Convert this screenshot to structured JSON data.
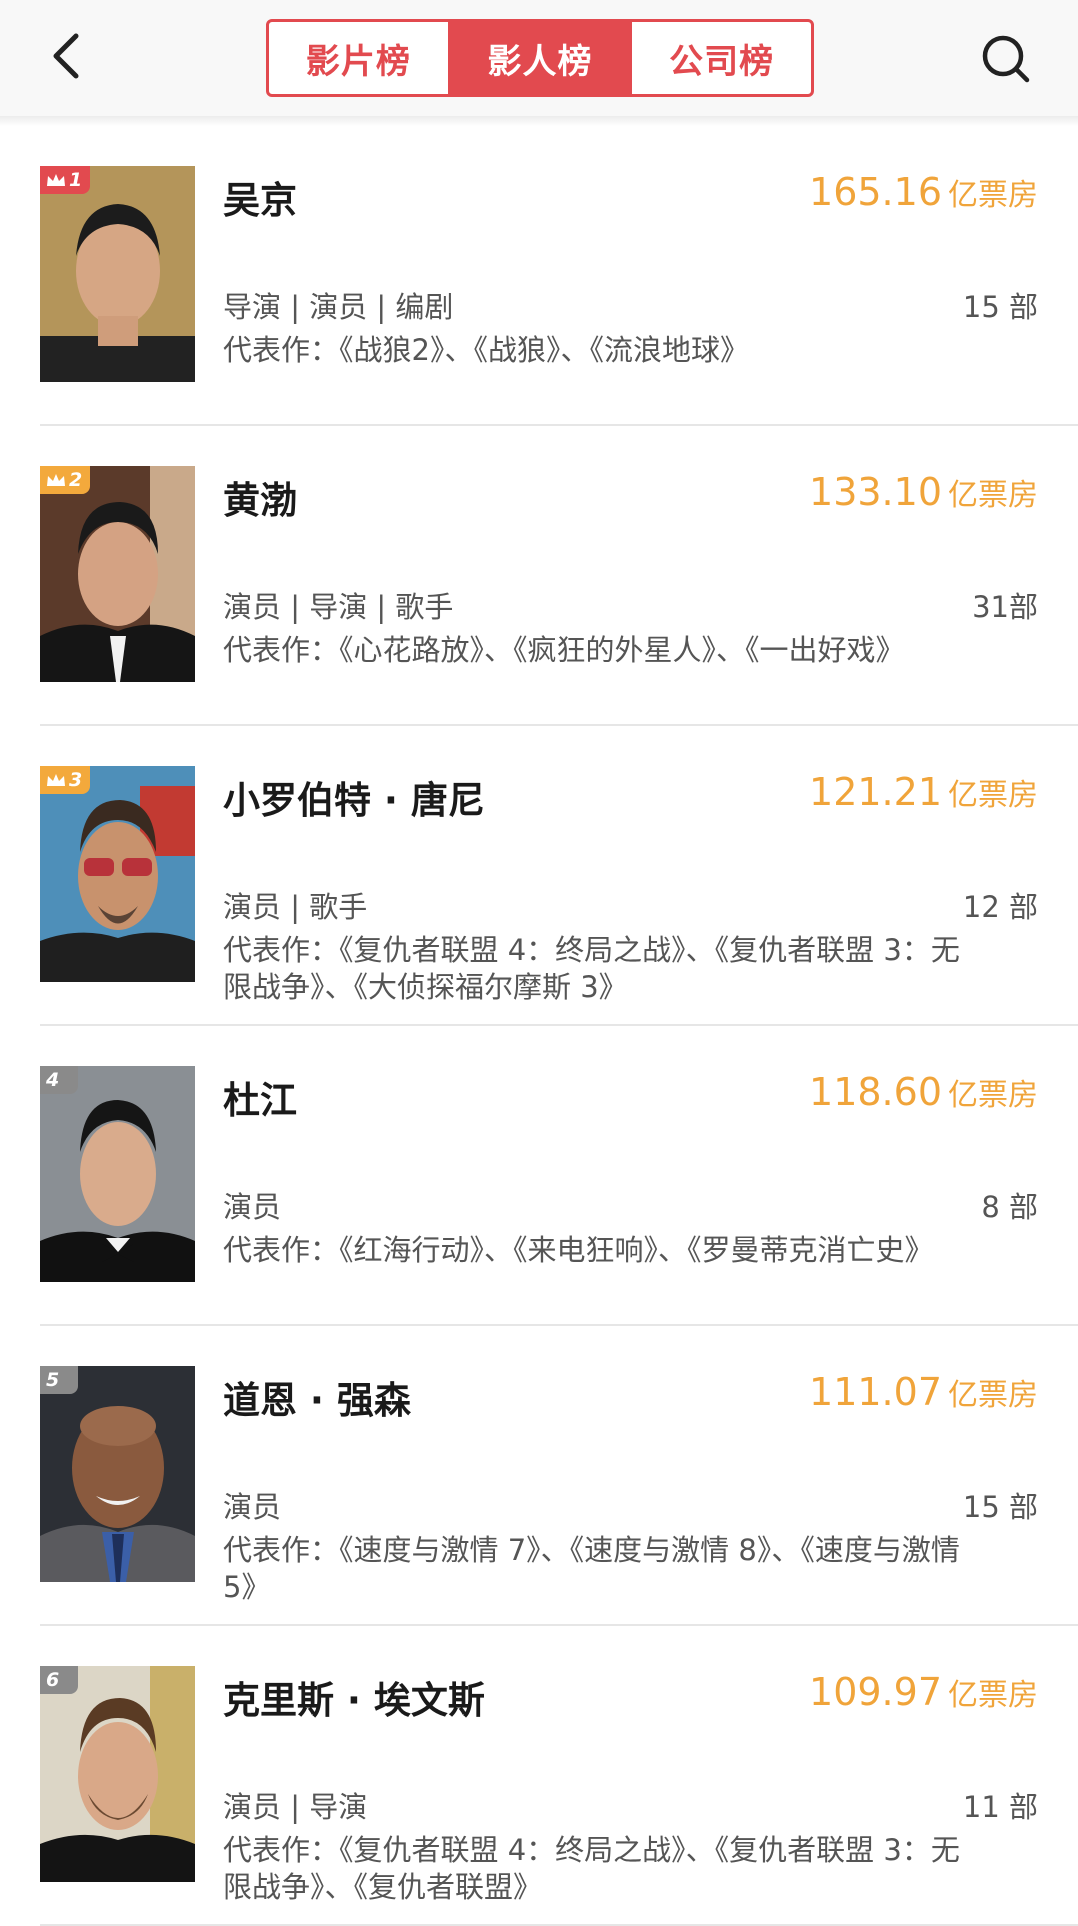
{
  "header": {
    "back_icon": "chevron-left-icon",
    "search_icon": "search-icon",
    "tabs": [
      {
        "label": "影片榜",
        "active": false
      },
      {
        "label": "影人榜",
        "active": true
      },
      {
        "label": "公司榜",
        "active": false
      }
    ]
  },
  "colors": {
    "accent": "#e24a4f",
    "box_office": "#f0a43a",
    "rank_top3": "#f3a93c",
    "rank_1": "#e24a4f",
    "rank_other": "#8a8a8a"
  },
  "list": {
    "unit": "亿票房",
    "works_prefix": "代表作：",
    "items": [
      {
        "rank": "1",
        "name": "吴京",
        "box_office": "165.16",
        "roles": "导演 | 演员 | 编剧",
        "count": "15 部",
        "works": "代表作：《战狼2》、《战狼》、《流浪地球》"
      },
      {
        "rank": "2",
        "name": "黄渤",
        "box_office": "133.10",
        "roles": "演员 | 导演 | 歌手",
        "count": "31部",
        "works": "代表作：《心花路放》、《疯狂的外星人》、《一出好戏》"
      },
      {
        "rank": "3",
        "name": "小罗伯特 · 唐尼",
        "box_office": "121.21",
        "roles": "演员 | 歌手",
        "count": "12 部",
        "works": "代表作：《复仇者联盟 4：终局之战》、《复仇者联盟 3：无限战争》、《大侦探福尔摩斯 3》"
      },
      {
        "rank": "4",
        "name": "杜江",
        "box_office": "118.60",
        "roles": "演员",
        "count": "8 部",
        "works": "代表作：《红海行动》、《来电狂响》、《罗曼蒂克消亡史》"
      },
      {
        "rank": "5",
        "name": "道恩 · 强森",
        "box_office": "111.07",
        "roles": "演员",
        "count": "15 部",
        "works": "代表作：《速度与激情 7》、《速度与激情 8》、《速度与激情 5》"
      },
      {
        "rank": "6",
        "name": "克里斯 · 埃文斯",
        "box_office": "109.97",
        "roles": "演员 | 导演",
        "count": "11 部",
        "works": "代表作：《复仇者联盟 4：终局之战》、《复仇者联盟 3：无限战争》、《复仇者联盟》"
      }
    ]
  }
}
